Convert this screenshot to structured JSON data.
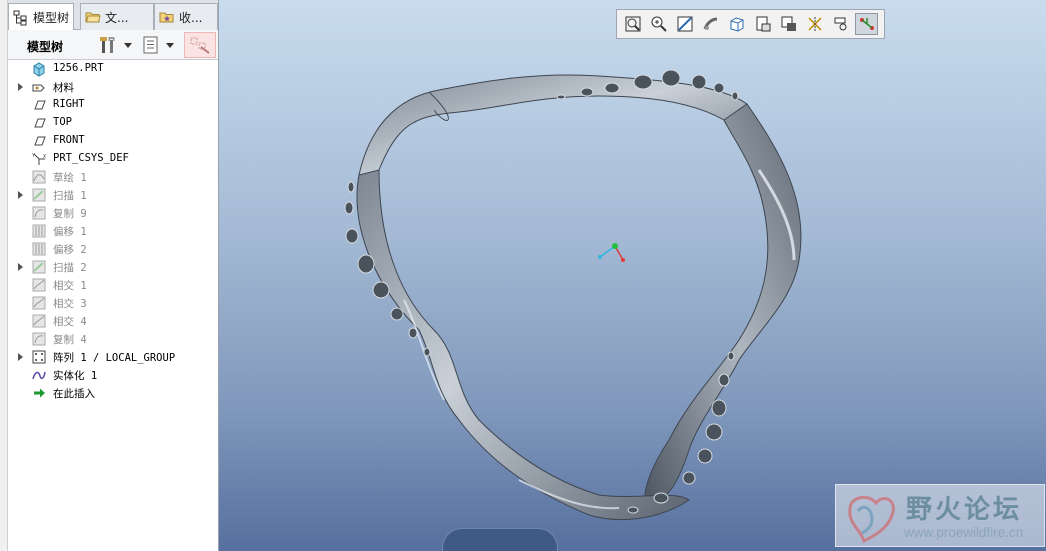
{
  "tabs": [
    {
      "label": "模型树",
      "icon": "model-tree-icon",
      "active": true
    },
    {
      "label": "文...",
      "icon": "folder-browser-icon",
      "active": false
    },
    {
      "label": "收...",
      "icon": "favorites-icon",
      "active": false
    }
  ],
  "tree_toolbar": {
    "title": "模型树",
    "tools_icon": "hammer-wrench-icon",
    "show_icon": "list-settings-icon",
    "filter_icon": "filter-icon"
  },
  "tree": [
    {
      "label": "1256.PRT",
      "icon": "part-icon",
      "dim": false,
      "expandable": false
    },
    {
      "label": "材料",
      "icon": "material-icon",
      "dim": false,
      "expandable": true
    },
    {
      "label": "RIGHT",
      "icon": "datum-plane-icon",
      "dim": false,
      "expandable": false
    },
    {
      "label": "TOP",
      "icon": "datum-plane-icon",
      "dim": false,
      "expandable": false
    },
    {
      "label": "FRONT",
      "icon": "datum-plane-icon",
      "dim": false,
      "expandable": false
    },
    {
      "label": "PRT_CSYS_DEF",
      "icon": "coordinate-system-icon",
      "dim": false,
      "expandable": false
    },
    {
      "label": "草绘 1",
      "icon": "sketch-icon",
      "dim": true,
      "expandable": false
    },
    {
      "label": "扫描 1",
      "icon": "sweep-icon",
      "dim": true,
      "expandable": true
    },
    {
      "label": "复制 9",
      "icon": "copy-icon",
      "dim": true,
      "expandable": false
    },
    {
      "label": "偏移 1",
      "icon": "offset-icon",
      "dim": true,
      "expandable": false
    },
    {
      "label": "偏移 2",
      "icon": "offset-icon",
      "dim": true,
      "expandable": false
    },
    {
      "label": "扫描 2",
      "icon": "sweep-icon",
      "dim": true,
      "expandable": true
    },
    {
      "label": "相交 1",
      "icon": "intersect-icon",
      "dim": true,
      "expandable": false
    },
    {
      "label": "相交 3",
      "icon": "intersect-icon",
      "dim": true,
      "expandable": false
    },
    {
      "label": "相交 4",
      "icon": "intersect-icon",
      "dim": true,
      "expandable": false
    },
    {
      "label": "复制 4",
      "icon": "copy-icon",
      "dim": true,
      "expandable": false
    },
    {
      "label": "阵列 1 / LOCAL_GROUP",
      "icon": "pattern-icon",
      "dim": false,
      "expandable": true
    },
    {
      "label": "实体化 1",
      "icon": "solidify-icon",
      "dim": false,
      "expandable": false
    },
    {
      "label": "在此插入",
      "icon": "insert-here-arrow-icon",
      "dim": false,
      "expandable": false
    }
  ],
  "view_toolbar": [
    {
      "name": "refit-icon",
      "active": false
    },
    {
      "name": "zoom-in-icon",
      "active": false
    },
    {
      "name": "zoom-out-icon",
      "active": false
    },
    {
      "name": "repaint-icon",
      "active": false
    },
    {
      "name": "display-style-icon",
      "active": false
    },
    {
      "name": "saved-orientations-icon",
      "active": false
    },
    {
      "name": "view-manager-icon",
      "active": false
    },
    {
      "name": "datum-display-icon",
      "active": false
    },
    {
      "name": "spin-center-icon",
      "active": false
    },
    {
      "name": "annotation-display-icon",
      "active": true
    }
  ],
  "watermark": {
    "title": "野火论坛",
    "url": "www.proewildfire.cn"
  },
  "colors": {
    "viewport_top": "#c9dcee",
    "viewport_bottom": "#566f9e",
    "axis_x": "#e23a3a",
    "axis_y": "#22c03c",
    "axis_z": "#2fb7e0"
  }
}
